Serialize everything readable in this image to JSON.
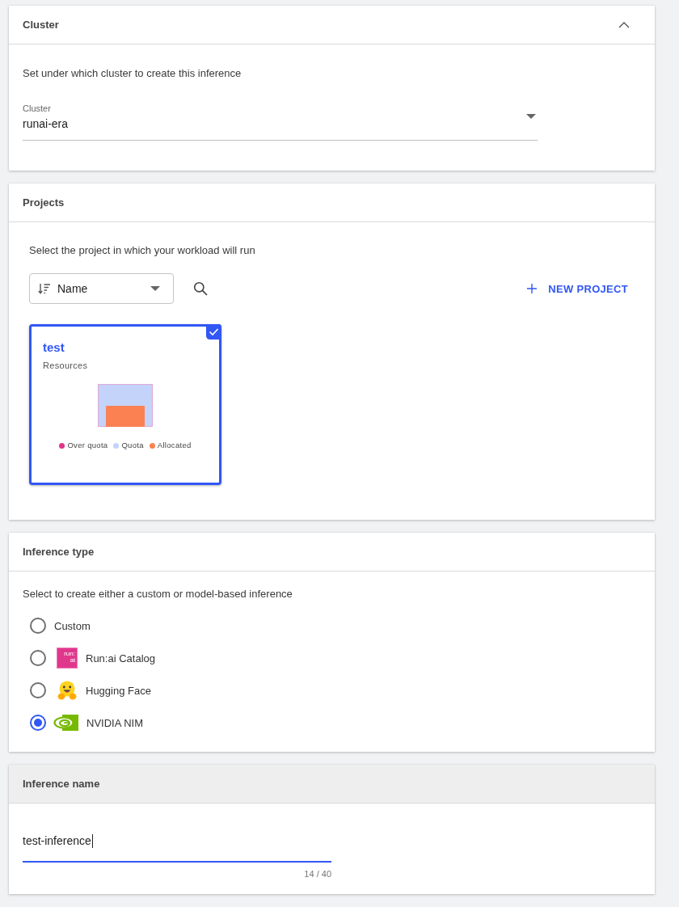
{
  "cluster": {
    "title": "Cluster",
    "expanded": true,
    "focused": false,
    "description": "Set under which cluster to create this inference",
    "field": {
      "label": "Cluster",
      "value": "runai-era"
    }
  },
  "projects": {
    "title": "Projects",
    "focused": false,
    "description": "Select the project in which your workload will run",
    "sort": {
      "value": "Name"
    },
    "new_project_button": "NEW PROJECT",
    "items": [
      {
        "name": "test",
        "subtitle": "Resources",
        "selected": true,
        "legend": [
          {
            "label": "Over quota",
            "color": "#e0348c"
          },
          {
            "label": "Quota",
            "color": "#c3d3fa"
          },
          {
            "label": "Allocated",
            "color": "#fb8152"
          }
        ]
      }
    ]
  },
  "inference_type": {
    "title": "Inference type",
    "focused": false,
    "description": "Select to create either a custom or model-based inference",
    "options": [
      {
        "label": "Custom",
        "kind": "plain",
        "selected": false
      },
      {
        "label": "Run:ai Catalog",
        "kind": "catalog",
        "logo_text": "run: ai",
        "selected": false
      },
      {
        "label": "Hugging Face",
        "kind": "hugging",
        "selected": false
      },
      {
        "label": "NVIDIA NIM",
        "kind": "nim",
        "selected": true
      }
    ]
  },
  "inference_name": {
    "title": "Inference name",
    "focused": true,
    "value": "test-inference",
    "counter": "14 / 40"
  }
}
